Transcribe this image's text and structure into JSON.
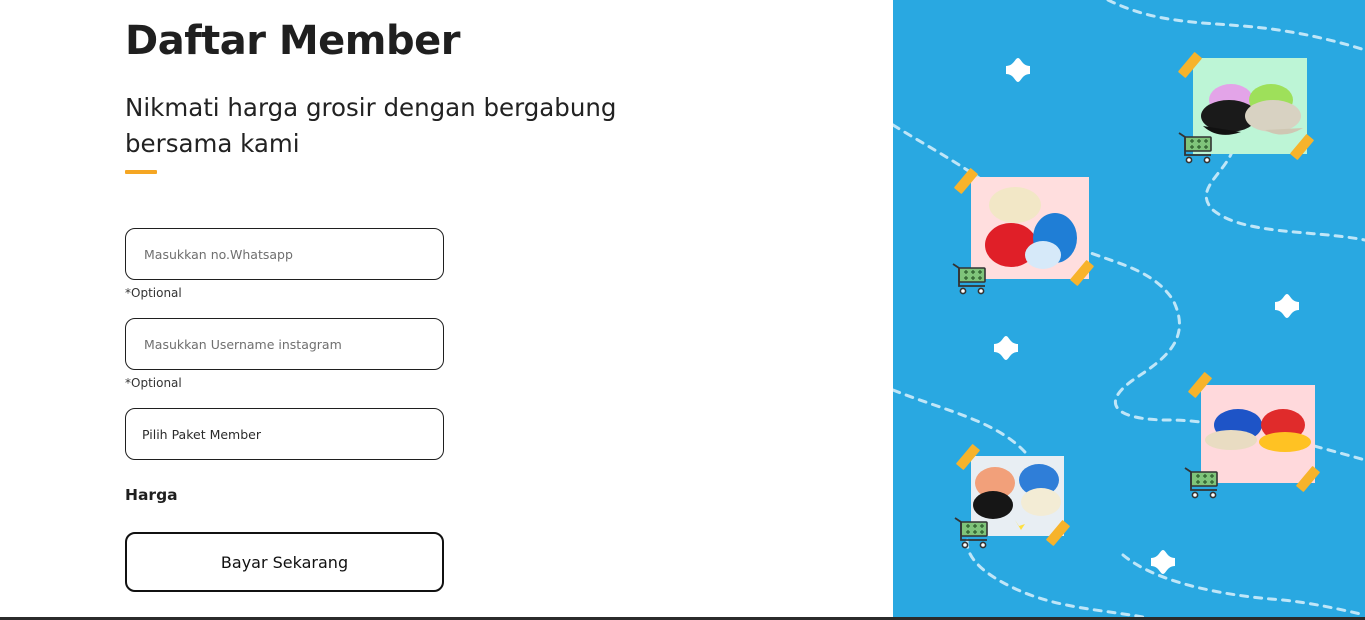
{
  "header": {
    "title": "Daftar Member",
    "subtitle": "Nikmati harga grosir dengan bergabung bersama kami"
  },
  "form": {
    "whatsapp": {
      "placeholder": "Masukkan no.Whatsapp",
      "value": "",
      "note": "*Optional"
    },
    "instagram": {
      "placeholder": "Masukkan Username instagram",
      "value": "",
      "note": "*Optional"
    },
    "paket": {
      "selected": "Pilih Paket Member"
    },
    "harga_label": "Harga",
    "submit_label": "Bayar Sekarang"
  },
  "colors": {
    "accent": "#f5a623",
    "panel_blue": "#29a8e1",
    "tape": "#f7b32b",
    "cart_green": "#7fc47a"
  },
  "decor": {
    "icons": [
      "sparkle-icon",
      "cart-icon",
      "tape-strip"
    ],
    "photos": [
      "cap-blackpink-photo",
      "bucket-hat-photo",
      "cap-yellow-red-photo",
      "cap-lost-bear-photo"
    ]
  }
}
